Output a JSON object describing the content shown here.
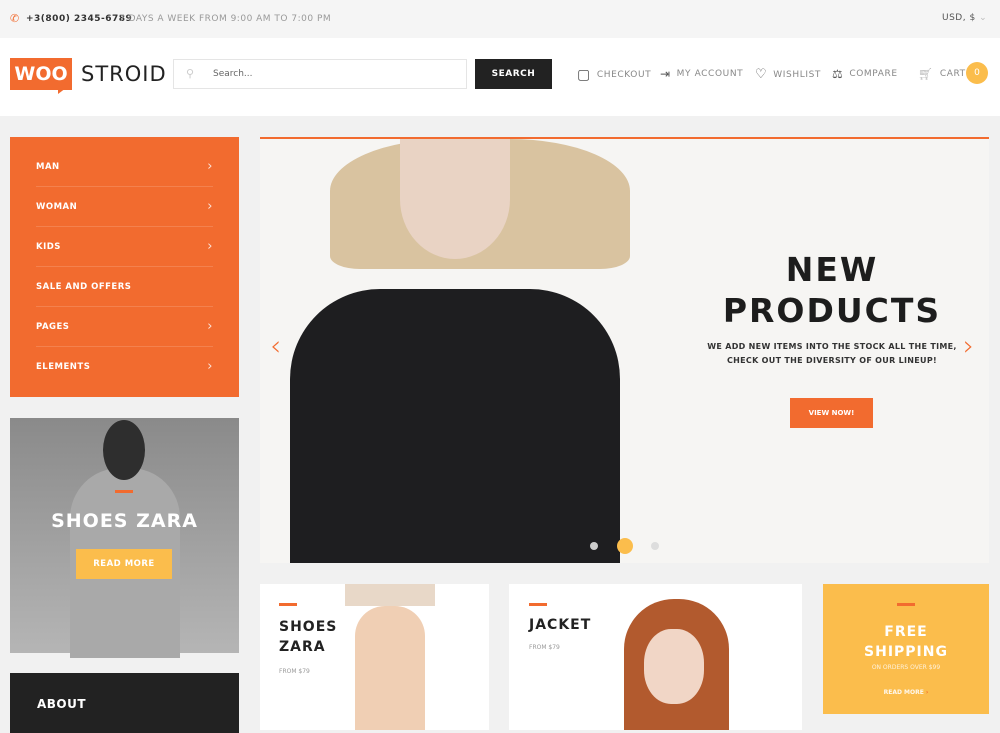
{
  "topbar": {
    "phone": "+3(800) 2345-6789",
    "hours": "7 DAYS A WEEK FROM 9:00 AM TO 7:00 PM",
    "currency": "USD, $"
  },
  "header": {
    "logo_box": "WOO",
    "logo_text": "STROID",
    "search_placeholder": "Search...",
    "search_button": "SEARCH",
    "links": {
      "checkout": "CHECKOUT",
      "account": "MY ACCOUNT",
      "wishlist": "WISHLIST",
      "compare": "COMPARE",
      "cart": "CART"
    },
    "cart_count": "0"
  },
  "menu": {
    "items": [
      "MAN",
      "WOMAN",
      "KIDS",
      "SALE AND OFFERS",
      "PAGES",
      "ELEMENTS"
    ]
  },
  "side_promo": {
    "title": "SHOES ZARA",
    "button": "READ MORE"
  },
  "about": {
    "title": "ABOUT"
  },
  "hero": {
    "title_line1": "NEW",
    "title_line2": "PRODUCTS",
    "desc_line1": "WE ADD NEW ITEMS INTO THE STOCK ALL THE TIME,",
    "desc_line2": "CHECK OUT THE DIVERSITY OF OUR LINEUP!",
    "button": "VIEW NOW!",
    "active_slide": 2,
    "slide_count": 3
  },
  "cards": [
    {
      "title_line1": "SHOES",
      "title_line2": "ZARA",
      "price": "FROM $79"
    },
    {
      "title_line1": "JACKET",
      "price": "FROM $79"
    },
    {
      "title_line1": "FREE",
      "title_line2": "SHIPPING",
      "subtitle": "ON ORDERS OVER $99",
      "link": "READ MORE"
    }
  ],
  "colors": {
    "accent": "#f26b2f",
    "yellow": "#fbbd4c",
    "dark": "#222222"
  }
}
